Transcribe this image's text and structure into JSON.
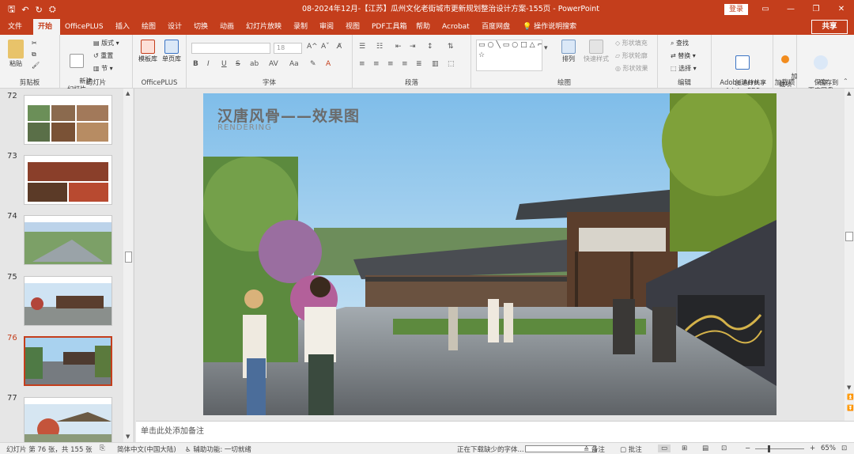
{
  "titlebar": {
    "title": "08-2024年12月-【江苏】瓜州文化老街城市更新规划整治设计方案-155页  -  PowerPoint",
    "login": "登录",
    "restore_icon": "restore-icon",
    "minimize_symbol": "—",
    "maximize_symbol": "❐",
    "close_symbol": "✕"
  },
  "tabs": [
    {
      "label": "文件"
    },
    {
      "label": "开始"
    },
    {
      "label": "OfficePLUS"
    },
    {
      "label": "插入"
    },
    {
      "label": "绘图"
    },
    {
      "label": "设计"
    },
    {
      "label": "切换"
    },
    {
      "label": "动画"
    },
    {
      "label": "幻灯片放映"
    },
    {
      "label": "录制"
    },
    {
      "label": "审阅"
    },
    {
      "label": "视图"
    },
    {
      "label": "PDF工具箱"
    },
    {
      "label": "帮助"
    },
    {
      "label": "Acrobat"
    },
    {
      "label": "百度网盘"
    },
    {
      "label": "操作说明搜索"
    }
  ],
  "share": "共享",
  "ribbon": {
    "clipboard": {
      "label": "剪贴板",
      "paste": "粘贴"
    },
    "slides": {
      "label": "幻灯片",
      "new_slide": "新建\n幻灯片",
      "layout": "版式",
      "reset": "重置",
      "section": "节"
    },
    "officeplus": {
      "label": "OfficePLUS",
      "template": "模板库",
      "single": "单页库"
    },
    "font": {
      "label": "字体",
      "size": "18",
      "bold": "B",
      "italic": "I",
      "underline": "U",
      "strike": "S",
      "shadow": "ab",
      "spacing": "AV",
      "case": "Aa",
      "color": "A"
    },
    "paragraph": {
      "label": "段落"
    },
    "drawing": {
      "label": "绘图",
      "arrange": "排列",
      "quick_styles": "快速样式",
      "fill": "形状填充",
      "outline": "形状轮廓",
      "effects": "形状效果"
    },
    "editing": {
      "label": "编辑",
      "find": "查找",
      "replace": "替换",
      "select": "选择"
    },
    "adobe": {
      "label": "Adobe Acro...",
      "create": "创建并共享\nAdobe PDF"
    },
    "addins": {
      "label": "加载项",
      "add": "加\n载项"
    },
    "save": {
      "label": "保存",
      "save_baidu": "保存到\n百度网盘"
    }
  },
  "thumbnails": [
    {
      "num": "72",
      "selected": false
    },
    {
      "num": "73",
      "selected": false
    },
    {
      "num": "74",
      "selected": false
    },
    {
      "num": "75",
      "selected": false
    },
    {
      "num": "76",
      "selected": true
    },
    {
      "num": "77",
      "selected": false
    }
  ],
  "slide": {
    "title": "汉唐风骨——效果图",
    "subtitle": "RENDERING"
  },
  "notes_placeholder": "单击此处添加备注",
  "statusbar": {
    "slide_info": "幻灯片 第 76 张，共 155 张",
    "language": "简体中文(中国大陆)",
    "accessibility": "辅助功能: 一切就绪",
    "downloading": "正在下载缺少的字体...",
    "notes": "备注",
    "comments": "批注",
    "zoom": "65%"
  },
  "colors": {
    "accent": "#c43e1c"
  }
}
